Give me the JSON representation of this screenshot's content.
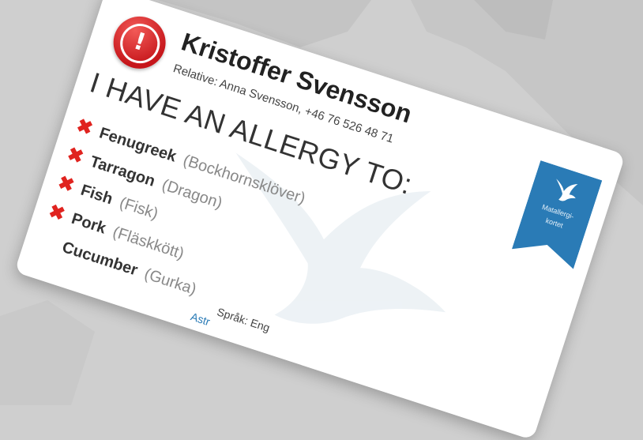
{
  "card": {
    "name": "Kristoffer Svensson",
    "relative": "Relative: Anna Svensson, +46 76 526 48 71",
    "heading": "I HAVE AN ALLERGY TO:",
    "allergies": [
      {
        "name": "Fenugreek",
        "local": "(Bockhornsklöver)"
      },
      {
        "name": "Tarragon",
        "local": "(Dragon)"
      },
      {
        "name": "Fish",
        "local": "(Fisk)"
      },
      {
        "name": "Pork",
        "local": "(Fläskkött)"
      },
      {
        "name": "Cucumber",
        "local": "(Gurka)"
      }
    ],
    "ribbon_text_1": "Matallergi-",
    "ribbon_text_2": "kortet",
    "footer_language": "Språk: Eng",
    "footer_link": "Astr"
  },
  "colors": {
    "alert_red": "#d62024",
    "x_red": "#e0231f",
    "ribbon_blue": "#2a7bb6",
    "background": "#cfcfcf"
  },
  "icons": [
    "exclamation-alert-icon",
    "x-mark-icon",
    "swallow-bird-icon"
  ]
}
